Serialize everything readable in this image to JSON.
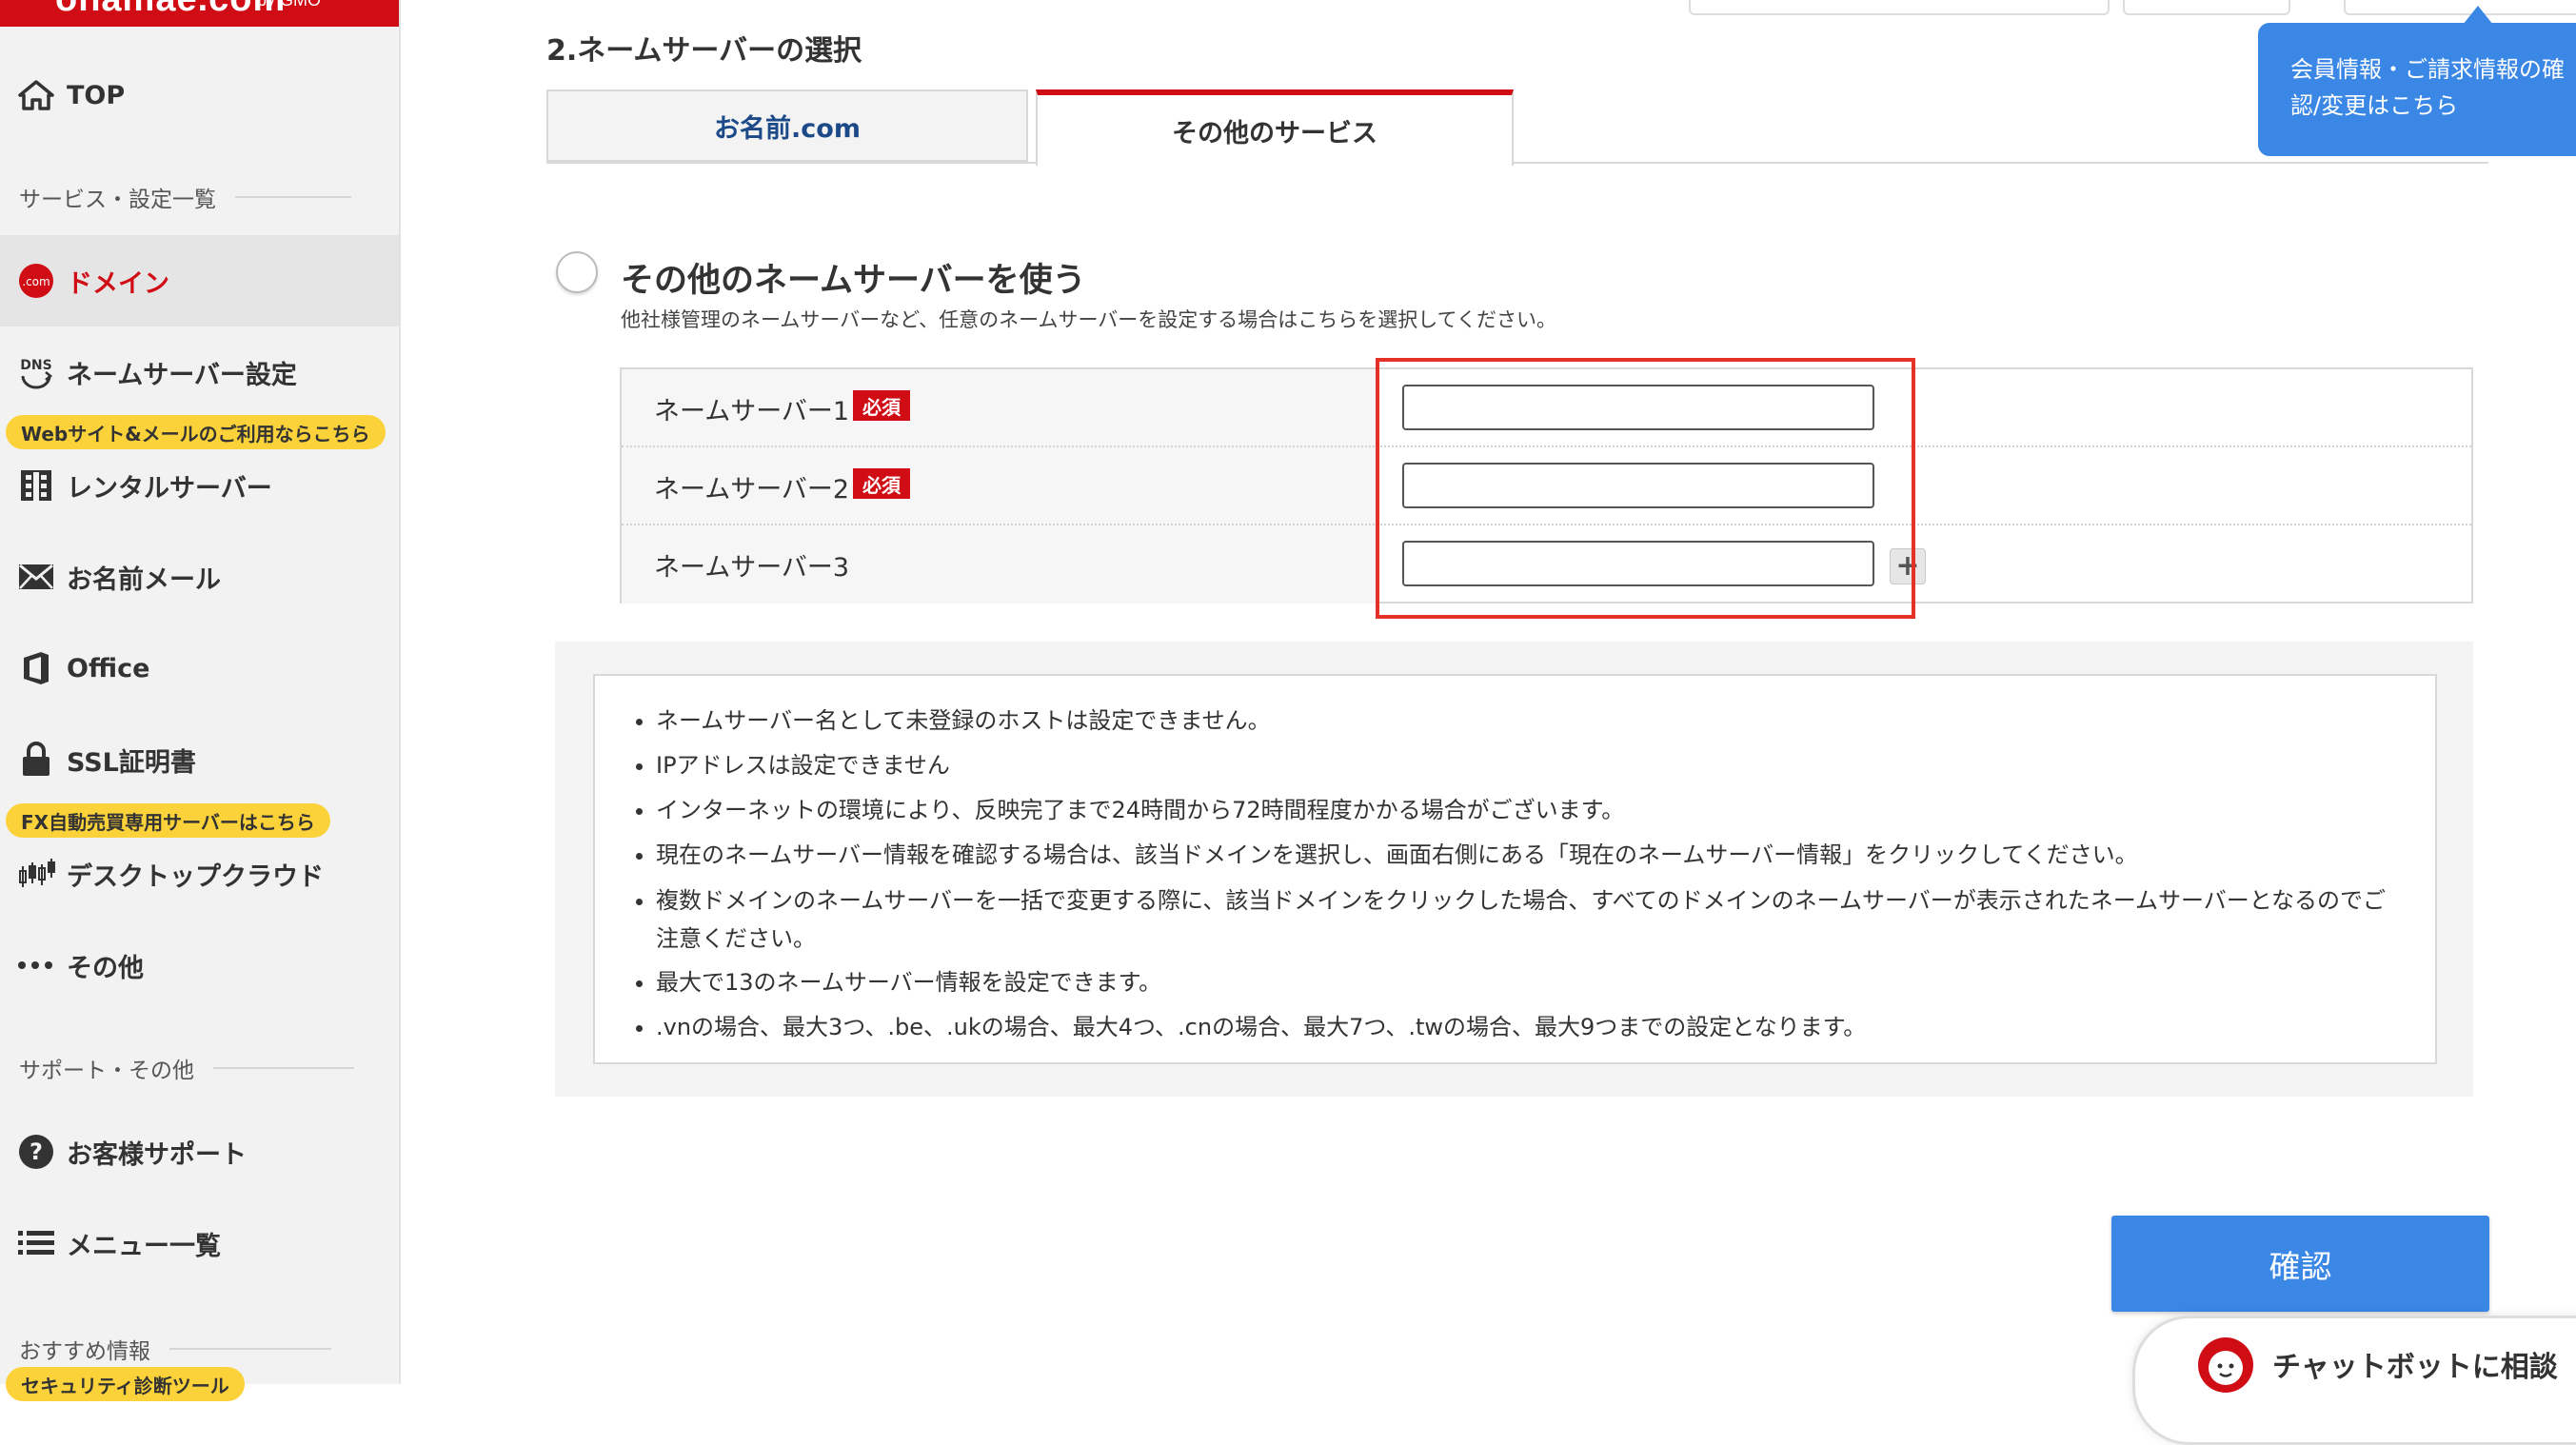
{
  "logo": {
    "text": "onamae.com",
    "sub": "by GMO"
  },
  "sidebar": {
    "top": "TOP",
    "services_label": "サービス・設定一覧",
    "items": [
      {
        "label": "ドメイン",
        "icon": "dotcom-icon",
        "active": true
      },
      {
        "label": "ネームサーバー設定",
        "icon": "dns-icon"
      },
      {
        "label": "レンタルサーバー",
        "icon": "server-icon"
      },
      {
        "label": "お名前メール",
        "icon": "mail-icon"
      },
      {
        "label": "Office",
        "icon": "office-icon"
      },
      {
        "label": "SSL証明書",
        "icon": "lock-icon"
      },
      {
        "label": "デスクトップクラウド",
        "icon": "chart-icon"
      },
      {
        "label": "その他",
        "icon": "more-icon"
      }
    ],
    "pill_web": "Webサイト&メールのご利用ならこちら",
    "pill_fx": "FX自動売買専用サーバーはこちら",
    "support_label": "サポート・その他",
    "support": "お客様サポート",
    "menu": "メニュー一覧",
    "recommend_label": "おすすめ情報",
    "pill_security": "セキュリティ診断ツール"
  },
  "tooltip": {
    "line1": "会員情報・ご請求情報の確",
    "line2": "認/変更はこちら"
  },
  "main": {
    "section_title": "2.ネームサーバーの選択",
    "tabs": [
      {
        "label": "お名前.com"
      },
      {
        "label": "その他のサービス",
        "active": true
      }
    ],
    "option_title": "その他のネームサーバーを使う",
    "option_desc": "他社様管理のネームサーバーなど、任意のネームサーバーを設定する場合はこちらを選択してください。",
    "required": "必須",
    "rows": [
      {
        "label": "ネームサーバー1",
        "value": ""
      },
      {
        "label": "ネームサーバー2",
        "value": ""
      },
      {
        "label": "ネームサーバー3",
        "value": ""
      }
    ],
    "add_label": "+",
    "notes": [
      "ネームサーバー名として未登録のホストは設定できません。",
      "IPアドレスは設定できません",
      "インターネットの環境により、反映完了まで24時間から72時間程度かかる場合がございます。",
      "現在のネームサーバー情報を確認する場合は、該当ドメインを選択し、画面右側にある「現在のネームサーバー情報」をクリックしてください。",
      "複数ドメインのネームサーバーを一括で変更する際に、該当ドメインをクリックした場合、すべてのドメインのネームサーバーが表示されたネームサーバーとなるのでご注意ください。",
      "最大で13のネームサーバー情報を設定できます。",
      ".vnの場合、最大3つ、.be、.ukの場合、最大4つ、.cnの場合、最大7つ、.twの場合、最大9つまでの設定となります。"
    ],
    "confirm": "確認",
    "chatbot": "チャットボットに相談"
  },
  "colors": {
    "brand": "#d00d15",
    "accent": "#3a87e6",
    "pill": "#fbd23a",
    "highlight": "#e53228"
  }
}
